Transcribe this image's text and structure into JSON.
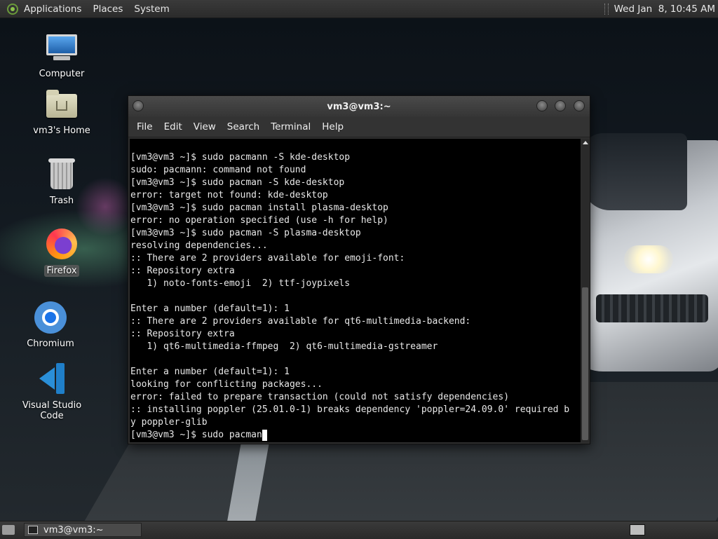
{
  "top_panel": {
    "menus": [
      "Applications",
      "Places",
      "System"
    ],
    "clock": "Wed Jan  8, 10:45 AM"
  },
  "desktop_icons": [
    {
      "label": "Computer",
      "icon": "computer-icon"
    },
    {
      "label": "vm3's Home",
      "icon": "home-folder-icon"
    },
    {
      "label": "Trash",
      "icon": "trash-icon"
    },
    {
      "label": "Firefox",
      "icon": "firefox-icon",
      "selected": true
    },
    {
      "label": "Chromium",
      "icon": "chromium-icon"
    },
    {
      "label": "Visual Studio Code",
      "icon": "vscode-icon"
    }
  ],
  "terminal": {
    "title": "vm3@vm3:~",
    "menu": [
      "File",
      "Edit",
      "View",
      "Search",
      "Terminal",
      "Help"
    ],
    "output": "[vm3@vm3 ~]$ sudo pacmann -S kde-desktop\nsudo: pacmann: command not found\n[vm3@vm3 ~]$ sudo pacman -S kde-desktop\nerror: target not found: kde-desktop\n[vm3@vm3 ~]$ sudo pacman install plasma-desktop\nerror: no operation specified (use -h for help)\n[vm3@vm3 ~]$ sudo pacman -S plasma-desktop\nresolving dependencies...\n:: There are 2 providers available for emoji-font:\n:: Repository extra\n   1) noto-fonts-emoji  2) ttf-joypixels\n\nEnter a number (default=1): 1\n:: There are 2 providers available for qt6-multimedia-backend:\n:: Repository extra\n   1) qt6-multimedia-ffmpeg  2) qt6-multimedia-gstreamer\n\nEnter a number (default=1): 1\nlooking for conflicting packages...\nerror: failed to prepare transaction (could not satisfy dependencies)\n:: installing poppler (25.01.0-1) breaks dependency 'poppler=24.09.0' required b\ny poppler-glib",
    "current_input": "[vm3@vm3 ~]$ sudo pacman"
  },
  "taskbar": {
    "task_label": "vm3@vm3:~"
  }
}
